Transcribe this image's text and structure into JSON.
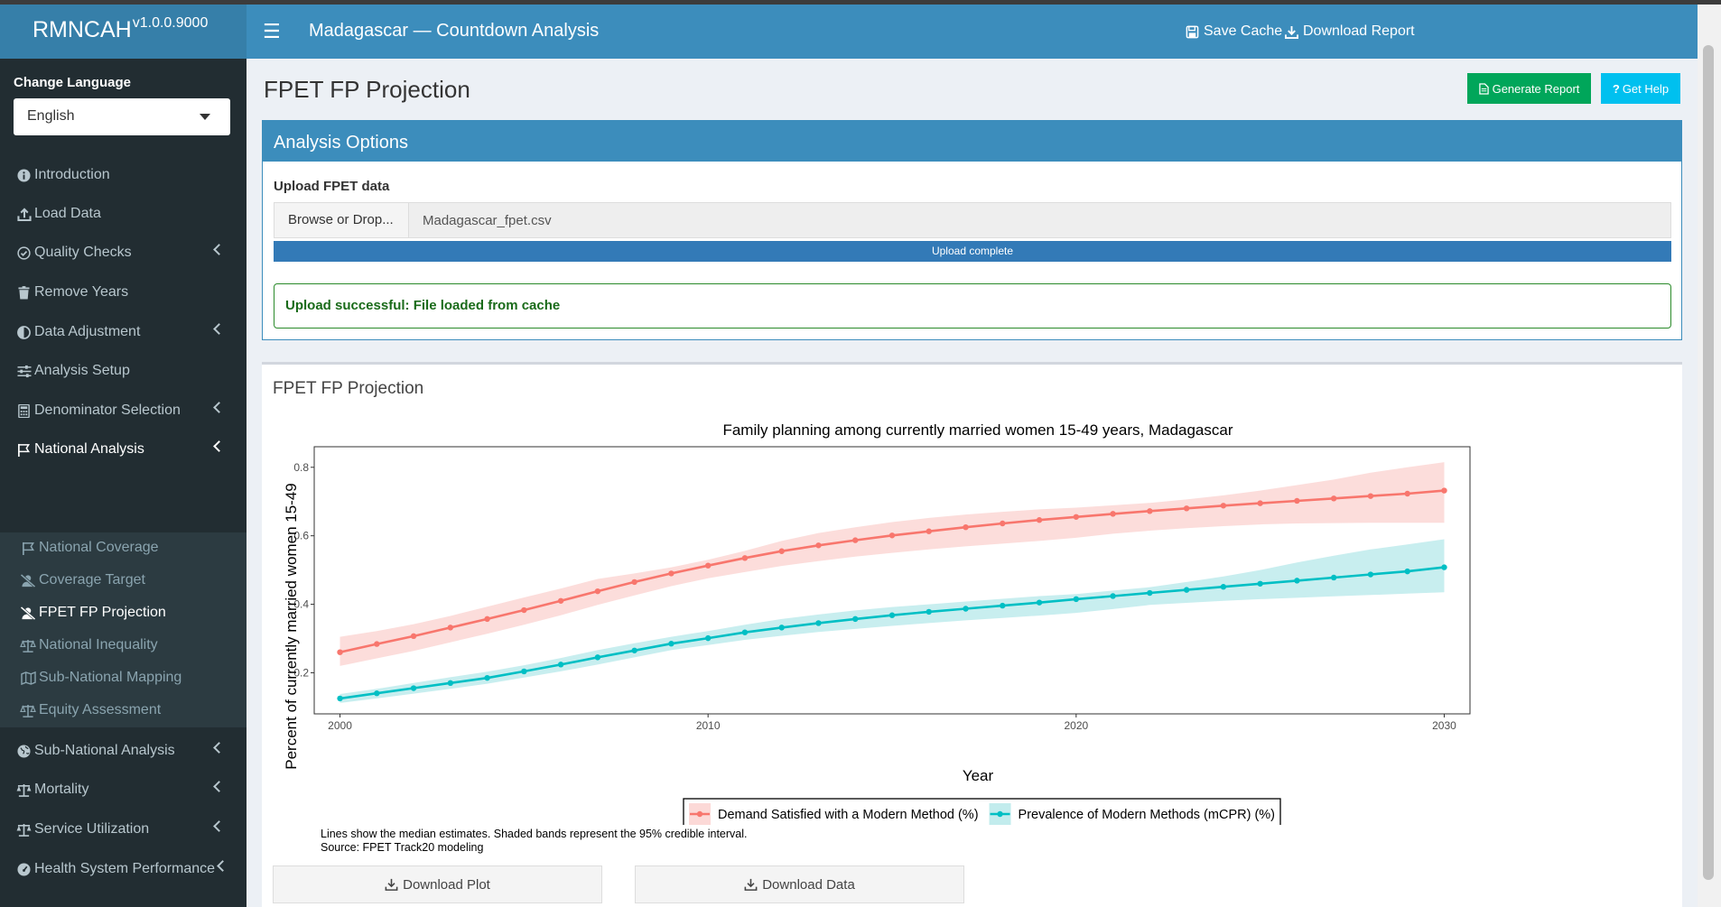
{
  "app": {
    "name": "RMNCAH",
    "version": "v1.0.0.9000"
  },
  "header": {
    "title": "Madagascar — Countdown Analysis",
    "save_cache": "Save Cache",
    "download_report": "Download Report"
  },
  "sidebar": {
    "language_label": "Change Language",
    "language_value": "English",
    "items": [
      {
        "label": "Introduction",
        "icon": "info-circle-icon"
      },
      {
        "label": "Load Data",
        "icon": "upload-icon"
      },
      {
        "label": "Quality Checks",
        "icon": "check-circle-icon"
      },
      {
        "label": "Remove Years",
        "icon": "trash-icon"
      },
      {
        "label": "Data Adjustment",
        "icon": "adjust-icon"
      },
      {
        "label": "Analysis Setup",
        "icon": "sliders-icon"
      },
      {
        "label": "Denominator Selection",
        "icon": "calculator-icon"
      },
      {
        "label": "National Analysis",
        "icon": "flag-icon"
      }
    ],
    "subitems": [
      {
        "label": "National Coverage",
        "icon": "flag-outline-icon"
      },
      {
        "label": "Coverage Target",
        "icon": "user-slash-icon"
      },
      {
        "label": "FPET FP Projection",
        "icon": "user-slash-icon"
      },
      {
        "label": "National Inequality",
        "icon": "balance-scale-icon"
      },
      {
        "label": "Sub-National Mapping",
        "icon": "map-icon"
      },
      {
        "label": "Equity Assessment",
        "icon": "balance-scale-icon"
      }
    ],
    "items_after": [
      {
        "label": "Sub-National Analysis",
        "icon": "globe-icon"
      },
      {
        "label": "Mortality",
        "icon": "balance-scale-icon"
      },
      {
        "label": "Service Utilization",
        "icon": "balance-scale-icon"
      },
      {
        "label": "Health System Performance",
        "icon": "tachometer-icon"
      }
    ]
  },
  "page": {
    "title": "FPET FP Projection",
    "generate_report": "Generate Report",
    "get_help": "Get Help"
  },
  "analysis_options": {
    "title": "Analysis Options",
    "upload_label": "Upload FPET data",
    "browse_label": "Browse or Drop...",
    "file_name": "Madagascar_fpet.csv",
    "progress_text": "Upload complete",
    "alert_text": "Upload successful: File loaded from cache"
  },
  "projection_box": {
    "title": "FPET FP Projection",
    "note_line1": "Lines show the median estimates. Shaded bands represent the 95% credible interval.",
    "note_line2": "Source: FPET Track20 modeling",
    "download_plot": "Download Plot",
    "download_data": "Download Data"
  },
  "chart_data": {
    "type": "line",
    "title": "Family planning among currently married women 15-49 years, Madagascar",
    "xlabel": "Year",
    "ylabel": "Percent of currently married women 15-49",
    "xlim": [
      1999.3,
      2030.7
    ],
    "ylim": [
      0.08,
      0.86
    ],
    "x_ticks": [
      2000,
      2010,
      2020,
      2030
    ],
    "y_ticks": [
      0.2,
      0.4,
      0.6,
      0.8
    ],
    "legend_position": "bottom",
    "grid": false,
    "x": [
      2000,
      2001,
      2002,
      2003,
      2004,
      2005,
      2006,
      2007,
      2008,
      2009,
      2010,
      2011,
      2012,
      2013,
      2014,
      2015,
      2016,
      2017,
      2018,
      2019,
      2020,
      2021,
      2022,
      2023,
      2024,
      2025,
      2026,
      2027,
      2028,
      2029,
      2030
    ],
    "series": [
      {
        "name": "Demand Satisfied with a Modern Method (%)",
        "color": "#f8766d",
        "band_color": "#fcd9d7",
        "values": [
          0.26,
          0.284,
          0.307,
          0.332,
          0.357,
          0.383,
          0.41,
          0.438,
          0.465,
          0.49,
          0.513,
          0.535,
          0.555,
          0.572,
          0.587,
          0.601,
          0.613,
          0.625,
          0.636,
          0.646,
          0.655,
          0.664,
          0.672,
          0.68,
          0.688,
          0.695,
          0.702,
          0.709,
          0.716,
          0.723,
          0.732
        ],
        "lower": [
          0.22,
          0.242,
          0.264,
          0.289,
          0.314,
          0.34,
          0.368,
          0.398,
          0.426,
          0.453,
          0.476,
          0.494,
          0.512,
          0.526,
          0.539,
          0.55,
          0.56,
          0.569,
          0.577,
          0.585,
          0.594,
          0.606,
          0.615,
          0.622,
          0.628,
          0.633,
          0.636,
          0.637,
          0.638,
          0.638,
          0.638
        ],
        "upper": [
          0.305,
          0.322,
          0.342,
          0.366,
          0.393,
          0.42,
          0.446,
          0.474,
          0.49,
          0.508,
          0.53,
          0.556,
          0.585,
          0.608,
          0.625,
          0.64,
          0.652,
          0.662,
          0.67,
          0.677,
          0.682,
          0.689,
          0.696,
          0.706,
          0.718,
          0.732,
          0.748,
          0.764,
          0.784,
          0.8,
          0.815
        ]
      },
      {
        "name": "Prevalence of Modern Methods (mCPR) (%)",
        "color": "#00bfc4",
        "band_color": "#c2eced",
        "values": [
          0.125,
          0.14,
          0.155,
          0.17,
          0.185,
          0.204,
          0.224,
          0.245,
          0.265,
          0.285,
          0.301,
          0.318,
          0.332,
          0.345,
          0.357,
          0.368,
          0.378,
          0.387,
          0.396,
          0.405,
          0.415,
          0.424,
          0.433,
          0.442,
          0.451,
          0.46,
          0.469,
          0.478,
          0.487,
          0.496,
          0.508
        ],
        "lower": [
          0.112,
          0.125,
          0.139,
          0.153,
          0.168,
          0.186,
          0.204,
          0.224,
          0.245,
          0.266,
          0.281,
          0.296,
          0.308,
          0.319,
          0.328,
          0.337,
          0.345,
          0.353,
          0.36,
          0.367,
          0.375,
          0.386,
          0.398,
          0.404,
          0.41,
          0.415,
          0.419,
          0.423,
          0.427,
          0.431,
          0.435
        ],
        "upper": [
          0.138,
          0.153,
          0.17,
          0.187,
          0.203,
          0.222,
          0.243,
          0.266,
          0.286,
          0.305,
          0.322,
          0.34,
          0.357,
          0.37,
          0.382,
          0.392,
          0.4,
          0.408,
          0.416,
          0.424,
          0.43,
          0.44,
          0.45,
          0.465,
          0.481,
          0.5,
          0.522,
          0.542,
          0.56,
          0.575,
          0.59
        ]
      }
    ]
  }
}
